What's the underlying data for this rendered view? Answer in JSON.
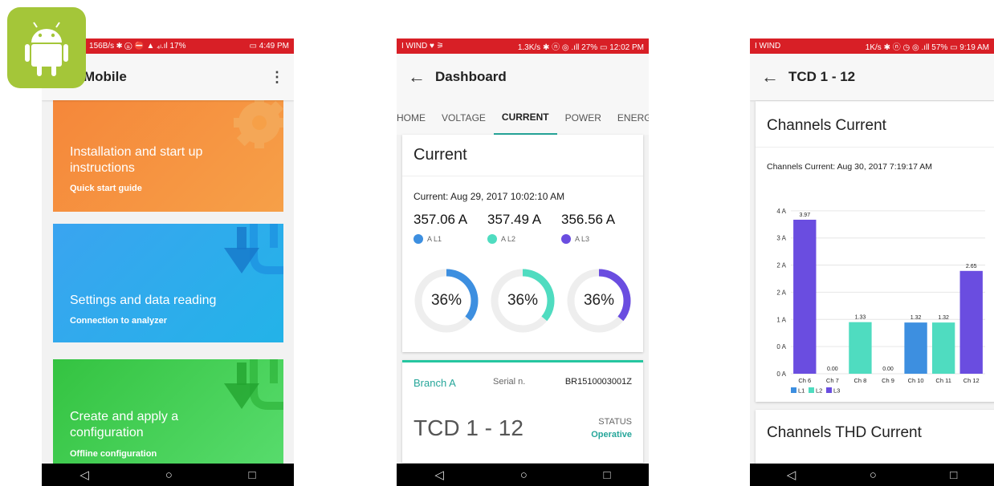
{
  "phone1": {
    "statusbar": {
      "left": "⚿ ▦ ▤ 🕨 ··· 156B/s ✱ ⓝ ⛔ ▲ ₄ₗ.ıl 17%",
      "right": "▭ 4:49 PM"
    },
    "app_title": "Mobile",
    "menu_icon": "more-vert-icon",
    "cards": [
      {
        "title": "Installation and start up instructions",
        "subtitle": "Quick start guide",
        "color": "#f5873a",
        "icon": "gear-icon"
      },
      {
        "title": "Settings and data reading",
        "subtitle": "Connection to analyzer",
        "color": "#3aa4f0",
        "icon": "download-arrow-icon"
      },
      {
        "title": "Create and apply a configuration",
        "subtitle": "Offline configuration",
        "color": "#34c341",
        "icon": "download-arrow-icon"
      }
    ]
  },
  "android_logo": {
    "icon": "android-icon",
    "color": "#a4c639"
  },
  "phone2": {
    "statusbar": {
      "left": "I WIND ♥ ⚞",
      "right": "1.3K/s ✱ ⓝ ◎ .ıll 27% ▭ 12:02 PM"
    },
    "app_title": "Dashboard",
    "tabs": [
      "HOME",
      "VOLTAGE",
      "CURRENT",
      "POWER",
      "ENERGY"
    ],
    "active_tab": "CURRENT",
    "current_card": {
      "title": "Current",
      "timestamp": "Current: Aug 29, 2017 10:02:10 AM",
      "phases": [
        {
          "value": "357.06 A",
          "label": "A L1",
          "color": "#3d8fe0",
          "percent_text": "36%",
          "percent": 36
        },
        {
          "value": "357.49 A",
          "label": "A L2",
          "color": "#4fdcc0",
          "percent_text": "36%",
          "percent": 36
        },
        {
          "value": "356.56 A",
          "label": "A L3",
          "color": "#6a4de0",
          "percent_text": "36%",
          "percent": 36
        }
      ]
    },
    "branch_card": {
      "name": "Branch A",
      "serial_label": "Serial n.",
      "serial_value": "BR1510003001Z",
      "device": "TCD 1 - 12",
      "status_label": "STATUS",
      "status_value": "Operative"
    }
  },
  "phone3": {
    "statusbar": {
      "left": "I WIND",
      "right": "1K/s ✱ ⓝ ◷ ◎ .ıll 57% ▭ 9:19 AM"
    },
    "app_title": "TCD 1 - 12",
    "chart_card": {
      "title": "Channels Current",
      "timestamp": "Channels Current: Aug 30, 2017 7:19:17 AM"
    },
    "thd_card": {
      "title": "Channels THD Current"
    }
  },
  "chart_data": {
    "type": "bar",
    "title": "",
    "xlabel": "",
    "ylabel": "",
    "categories": [
      "Ch 6",
      "Ch 7",
      "Ch 8",
      "Ch 9",
      "Ch 10",
      "Ch 11",
      "Ch 12"
    ],
    "values": [
      3.97,
      0.0,
      1.33,
      0.0,
      1.32,
      1.32,
      2.65
    ],
    "value_labels": [
      "3.97",
      "0.00",
      "1.33",
      "0.00",
      "1.32",
      "1.32",
      "2.65"
    ],
    "bar_series": [
      "L3",
      "L1",
      "L2",
      "L1",
      "L1",
      "L2",
      "L3"
    ],
    "series_colors": {
      "L1": "#3d8fe0",
      "L2": "#4fdcc0",
      "L3": "#6a4de0"
    },
    "legend": [
      "L1",
      "L2",
      "L3"
    ],
    "legend_position": "bottom-left",
    "ylim": [
      0,
      4.3
    ],
    "yticks": [
      0,
      0.7,
      1.4,
      2.1,
      2.8,
      3.5,
      4.2
    ],
    "ytick_labels": [
      "0 A",
      "0 A",
      "1 A",
      "2 A",
      "2 A",
      "3 A",
      "4 A"
    ],
    "grid": true
  }
}
